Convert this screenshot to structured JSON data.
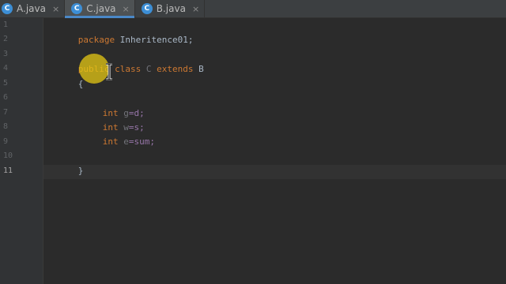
{
  "tabs": [
    {
      "icon_letter": "C",
      "label": "A.java",
      "close": "×",
      "active": false
    },
    {
      "icon_letter": "C",
      "label": "C.java",
      "close": "×",
      "active": true
    },
    {
      "icon_letter": "C",
      "label": "B.java",
      "close": "×",
      "active": false
    }
  ],
  "gutter": {
    "line_numbers": [
      "1",
      "2",
      "3",
      "4",
      "5",
      "6",
      "7",
      "8",
      "9",
      "10",
      "11"
    ],
    "current_line": "11"
  },
  "code": {
    "line1": {
      "kw": "package",
      "rest": " Inheritence01;"
    },
    "line3": {
      "kw1": "public",
      "sp1": " ",
      "kw2": "class",
      "sp2": " ",
      "name": "C",
      "sp3": " ",
      "kw3": "extends",
      "sp4": " ",
      "parent": "B"
    },
    "line4": {
      "text": "{"
    },
    "line6": {
      "kw": "int",
      "sp": " ",
      "field": "g",
      "rest": "=d;"
    },
    "line7": {
      "kw": "int",
      "sp": " ",
      "field": "w",
      "rest": "=s;"
    },
    "line8": {
      "kw": "int",
      "sp": " ",
      "field": "e",
      "rest": "=sum;"
    },
    "line10": {
      "text": "}"
    }
  },
  "colors": {
    "keyword": "#cc7832",
    "identifier": "#a9b7c6",
    "field": "#9876aa",
    "tab_accent": "#4a88c7",
    "cursor_highlight": "#e6c814"
  }
}
